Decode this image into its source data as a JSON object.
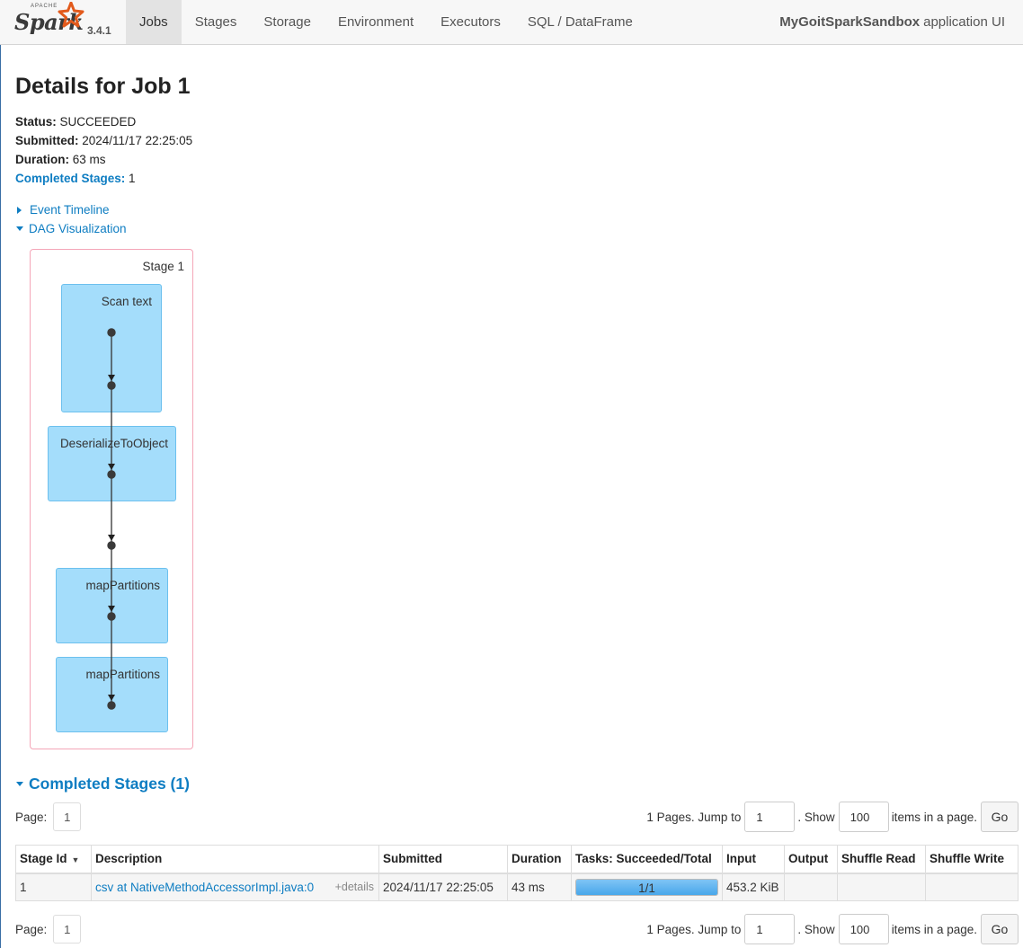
{
  "navbar": {
    "brand_apache": "APACHE",
    "brand_name": "Spark",
    "version": "3.4.1",
    "tabs": [
      {
        "label": "Jobs",
        "active": true
      },
      {
        "label": "Stages"
      },
      {
        "label": "Storage"
      },
      {
        "label": "Environment"
      },
      {
        "label": "Executors"
      },
      {
        "label": "SQL / DataFrame"
      }
    ],
    "app_name_bold": "MyGoitSparkSandbox",
    "app_name_suffix": "application UI"
  },
  "page": {
    "title": "Details for Job 1",
    "status_label": "Status:",
    "status_value": "SUCCEEDED",
    "submitted_label": "Submitted:",
    "submitted_value": "2024/11/17 22:25:05",
    "duration_label": "Duration:",
    "duration_value": "63 ms",
    "completed_stages_label": "Completed Stages:",
    "completed_stages_value": "1",
    "event_timeline": "Event Timeline",
    "dag_visualization": "DAG Visualization"
  },
  "dag": {
    "stage_label": "Stage 1",
    "nodes": [
      "Scan text",
      "DeserializeToObject",
      "mapPartitions",
      "mapPartitions"
    ]
  },
  "completed_stages": {
    "header": "Completed Stages (1)",
    "pager": {
      "page_label": "Page:",
      "current_page": "1",
      "pages_text": "1 Pages. Jump to",
      "jump_value": "1",
      "show_text": ". Show",
      "page_size": "100",
      "items_text": "items in a page.",
      "go_label": "Go"
    },
    "columns": [
      "Stage Id",
      "Description",
      "Submitted",
      "Duration",
      "Tasks: Succeeded/Total",
      "Input",
      "Output",
      "Shuffle Read",
      "Shuffle Write"
    ],
    "rows": [
      {
        "stage_id": "1",
        "description": "csv at NativeMethodAccessorImpl.java:0",
        "details": "+details",
        "submitted": "2024/11/17 22:25:05",
        "duration": "43 ms",
        "tasks": "1/1",
        "tasks_fraction": 1.0,
        "input": "453.2 KiB",
        "output": "",
        "shuffle_read": "",
        "shuffle_write": ""
      }
    ]
  },
  "colors": {
    "link": "#0e7dc2",
    "dag_node_fill": "#a4ddfb",
    "dag_stage_border": "#f4a6b8",
    "progress_fill": "#48a7ea"
  }
}
